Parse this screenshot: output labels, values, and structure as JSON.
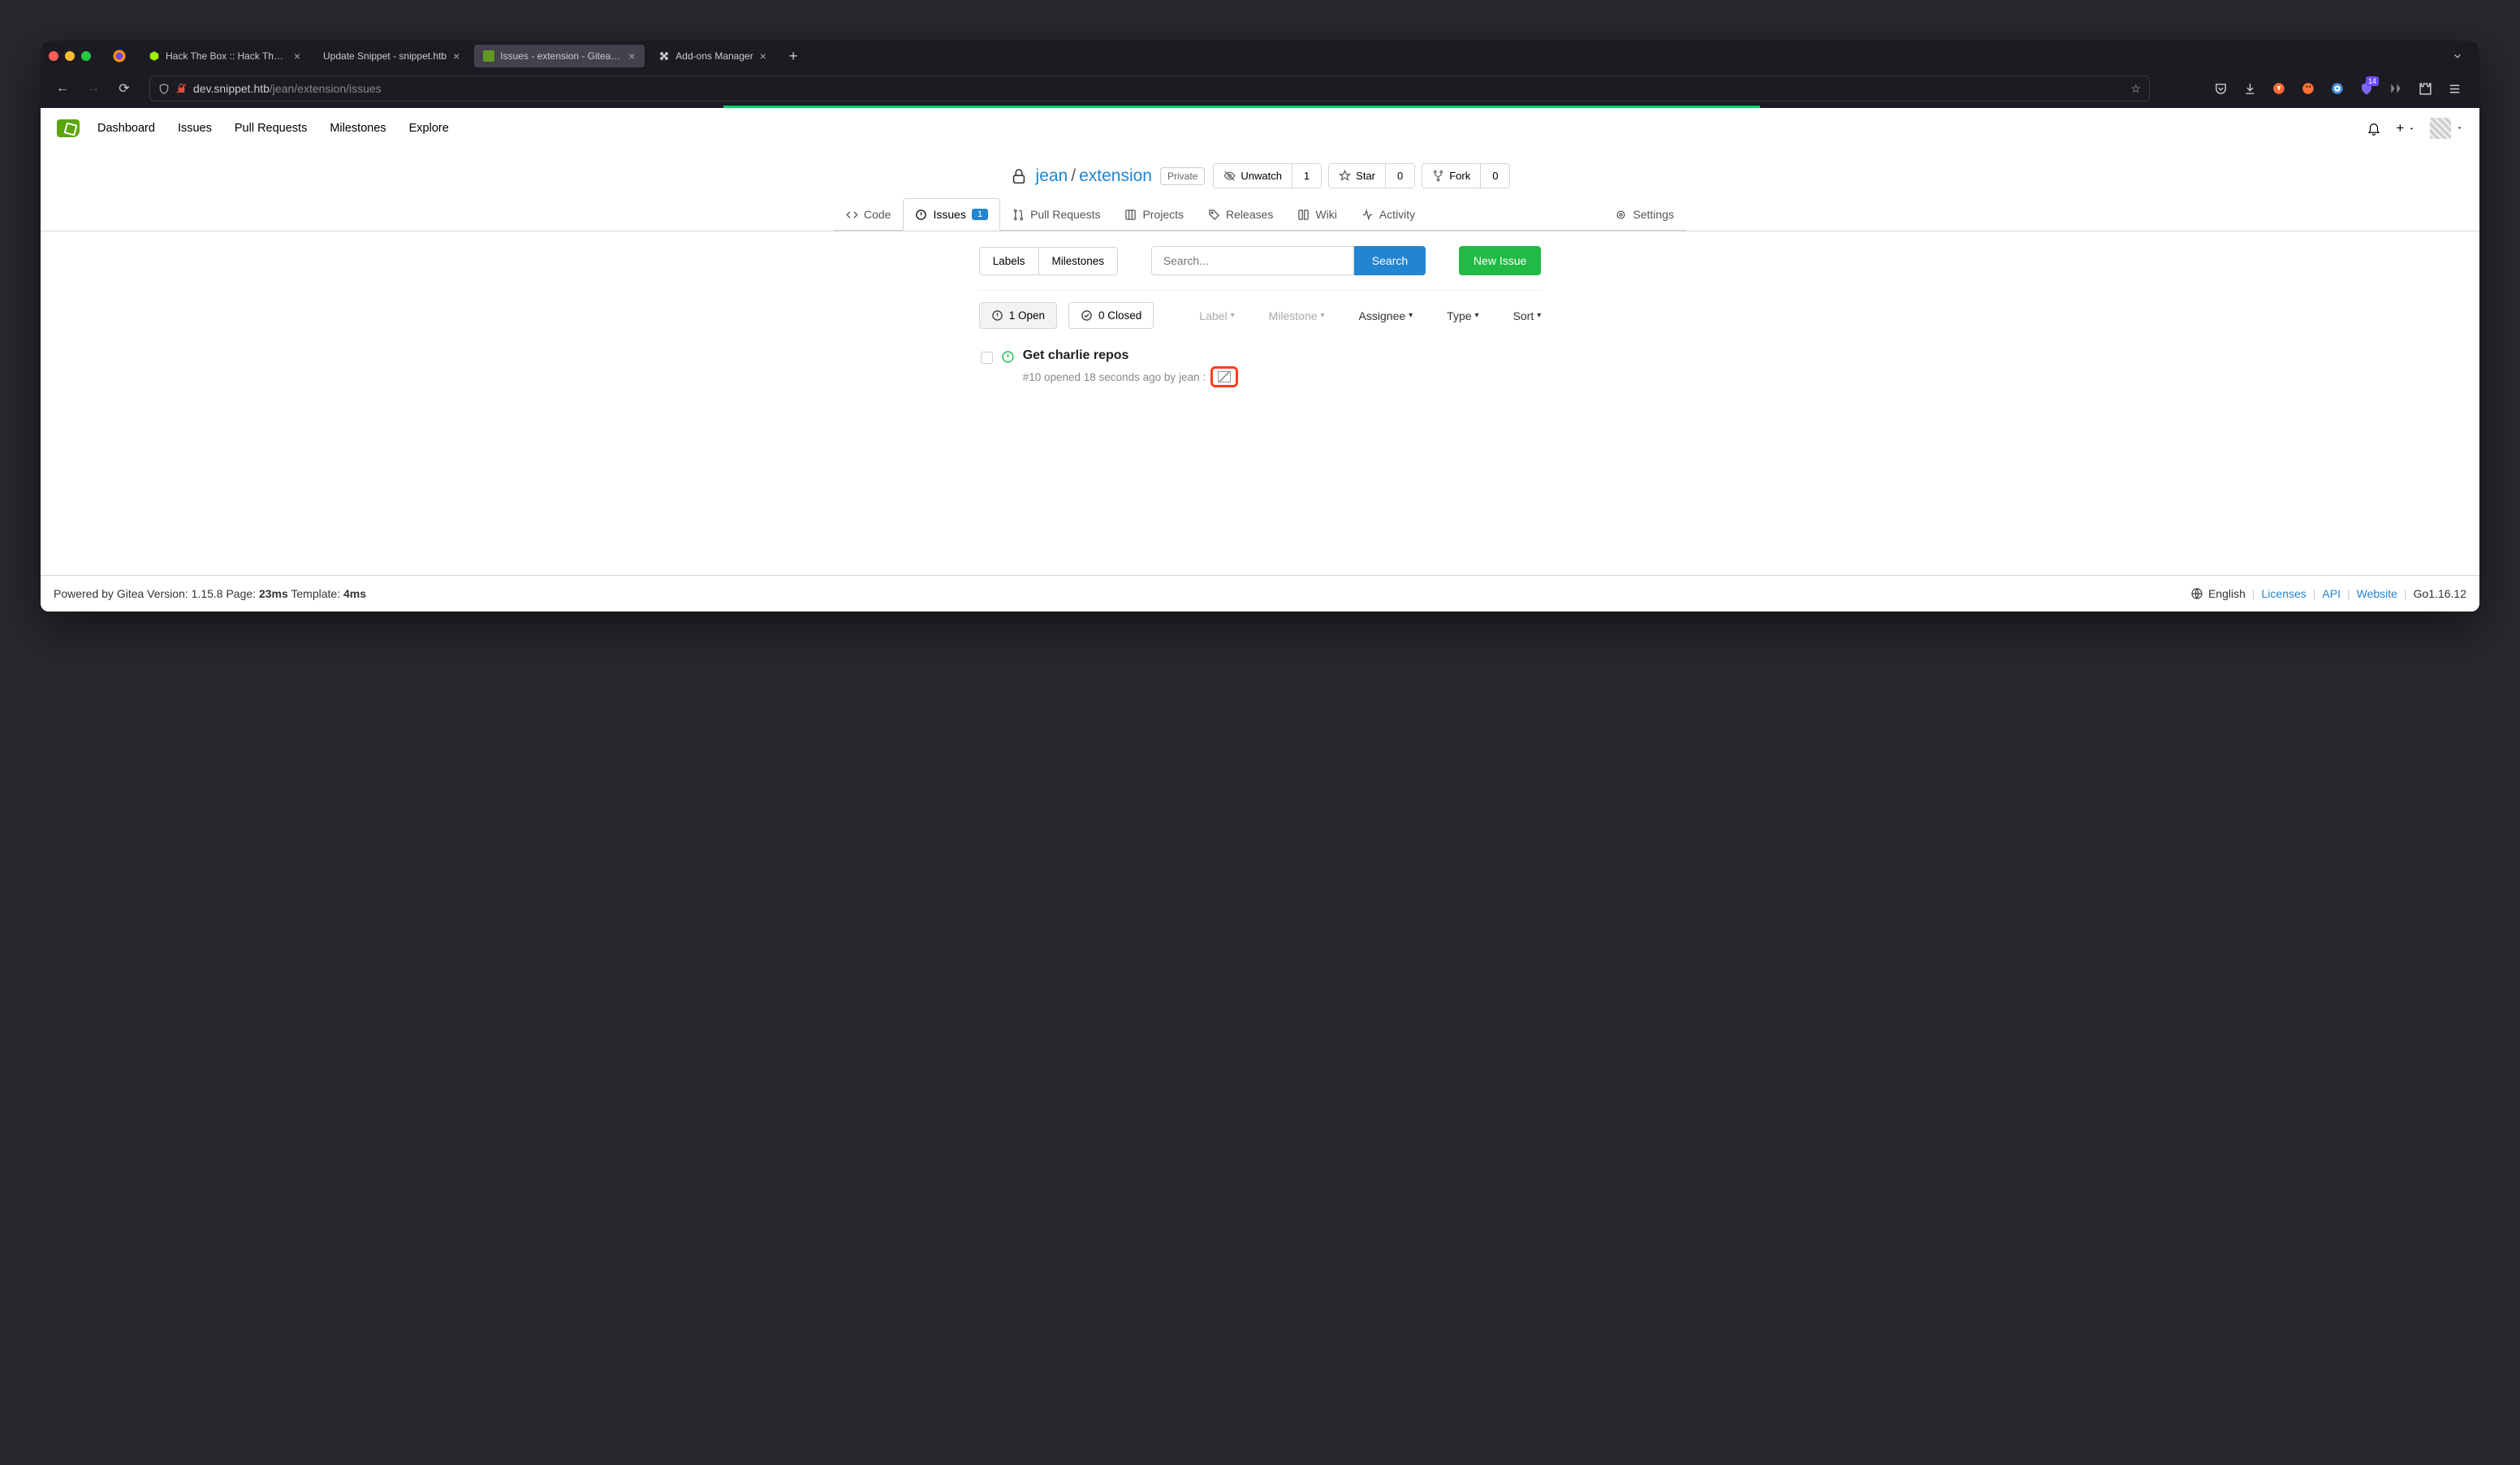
{
  "browser": {
    "tabs": [
      {
        "label": "Hack The Box :: Hack The Box",
        "favicon": "cube-green"
      },
      {
        "label": "Update Snippet - snippet.htb",
        "favicon": ""
      },
      {
        "label": "Issues - extension - Gitea: Git w",
        "favicon": "gitea",
        "active": true
      },
      {
        "label": "Add-ons Manager",
        "favicon": "puzzle"
      }
    ],
    "url_prefix": "dev.snippet.htb",
    "url_path": "/jean/extension/issues",
    "ext_badge": "14"
  },
  "nav": {
    "items": [
      "Dashboard",
      "Issues",
      "Pull Requests",
      "Milestones",
      "Explore"
    ]
  },
  "repo": {
    "owner": "jean",
    "name": "extension",
    "visibility": "Private",
    "actions": {
      "watch": {
        "label": "Unwatch",
        "count": "1"
      },
      "star": {
        "label": "Star",
        "count": "0"
      },
      "fork": {
        "label": "Fork",
        "count": "0"
      }
    }
  },
  "repo_tabs": {
    "code": "Code",
    "issues": {
      "label": "Issues",
      "count": "1"
    },
    "prs": "Pull Requests",
    "projects": "Projects",
    "releases": "Releases",
    "wiki": "Wiki",
    "activity": "Activity",
    "settings": "Settings"
  },
  "filters": {
    "labels": "Labels",
    "milestones": "Milestones",
    "search_placeholder": "Search...",
    "search_btn": "Search",
    "new_issue": "New Issue"
  },
  "states": {
    "open": "1 Open",
    "closed": "0 Closed",
    "dropdowns": [
      "Label",
      "Milestone",
      "Assignee",
      "Type",
      "Sort"
    ]
  },
  "issue": {
    "title": "Get charlie repos",
    "meta_prefix": "#10 opened 18 seconds ago by ",
    "author": "jean"
  },
  "footer": {
    "powered": "Powered by Gitea Version: 1.15.8 Page: ",
    "page_time": "23ms",
    "template_label": " Template: ",
    "template_time": "4ms",
    "lang": "English",
    "links": [
      "Licenses",
      "API",
      "Website"
    ],
    "go": "Go1.16.12"
  }
}
